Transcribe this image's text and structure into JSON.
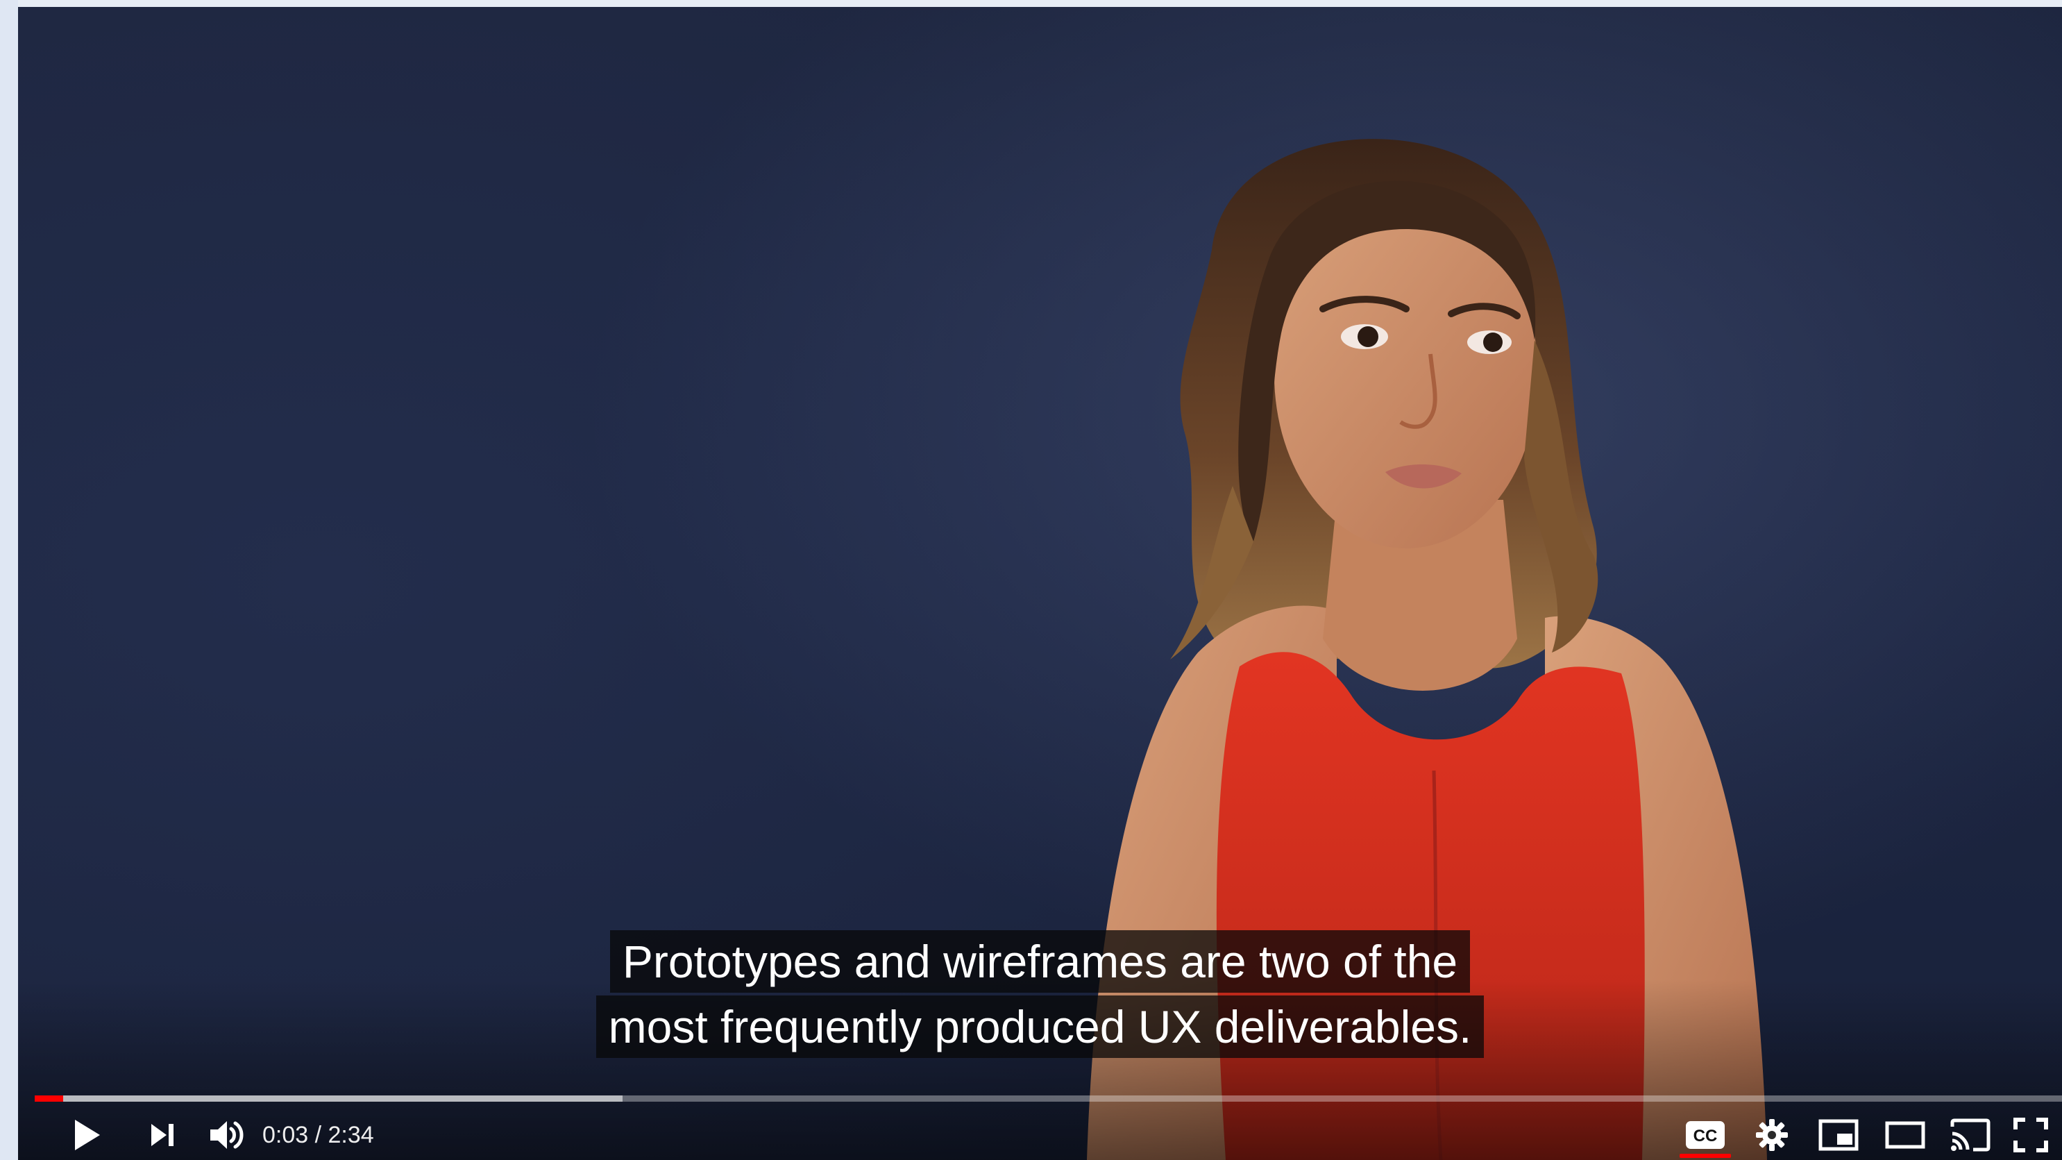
{
  "player": {
    "captions": {
      "line1": "Prototypes and wireframes are two of the",
      "line2": "most frequently produced UX deliverables."
    },
    "time": {
      "display": "0:03 / 2:34",
      "current": "0:03",
      "duration": "2:34"
    },
    "progress": {
      "played_fraction": 0.014,
      "loaded_fraction": 0.29
    },
    "controls": {
      "play_icon": "play-icon",
      "next_icon": "next-icon",
      "volume_icon": "volume-icon",
      "cc_label": "CC",
      "cc_active": true,
      "settings_icon": "gear-icon",
      "miniplayer_icon": "miniplayer-icon",
      "theater_icon": "theater-mode-icon",
      "cast_icon": "cast-icon",
      "fullscreen_icon": "fullscreen-icon"
    },
    "colors": {
      "progress_played": "#ff0000",
      "background": "#1e2640",
      "dress": "#d22d1f"
    }
  }
}
